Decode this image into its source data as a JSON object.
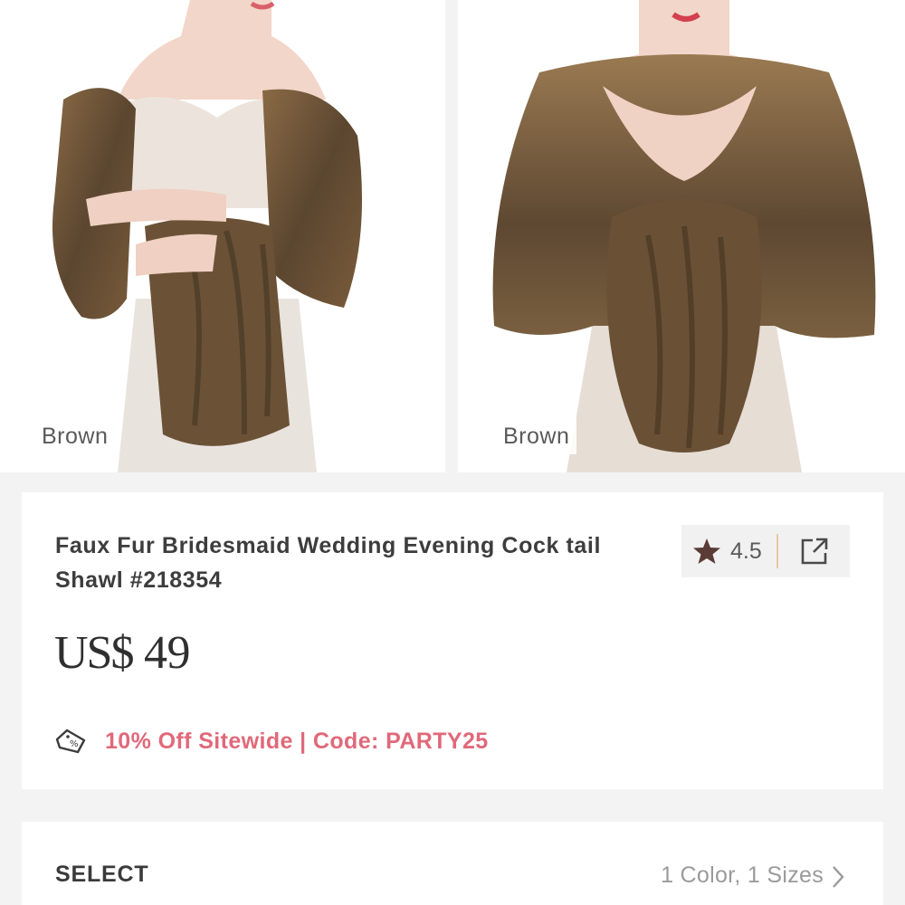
{
  "gallery": {
    "images": [
      {
        "color_label": "Brown"
      },
      {
        "color_label": "Brown"
      }
    ]
  },
  "product": {
    "title": "Faux Fur Bridesmaid Wedding Evening Cock tail Shawl #218354",
    "rating": "4.5",
    "price_currency": "US$",
    "price_amount": "49",
    "promo_text": "10% Off Sitewide | Code: PARTY25",
    "icons": {
      "rating": "star-icon",
      "share": "share-icon",
      "promo": "coupon-icon"
    }
  },
  "select": {
    "label": "SELECT",
    "summary": "1 Color, 1 Sizes",
    "icon": "chevron-right-icon"
  },
  "colors": {
    "promo": "#e0697a",
    "rating_divider": "#e7c9a3",
    "star": "#5a3b35"
  }
}
